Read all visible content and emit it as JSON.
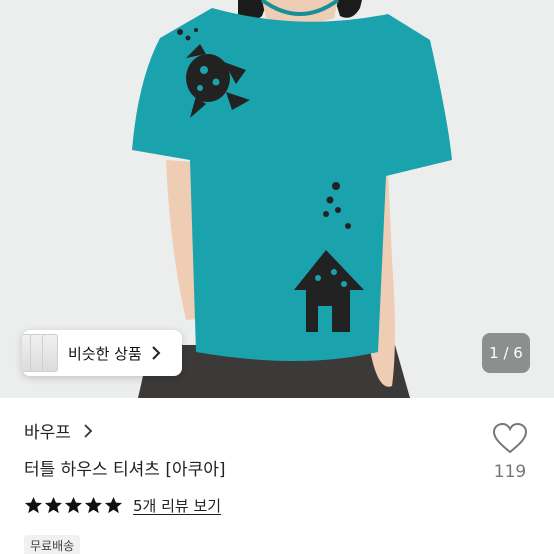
{
  "gallery": {
    "similar_label": "비슷한 상품",
    "counter": "1 / 6",
    "icons": {
      "similar_chevron": "chevron-right-icon"
    }
  },
  "product": {
    "shop_name": "바우프",
    "title": "터틀 하우스 티셔츠 [아쿠아]",
    "rating": 5,
    "rating_max": 5,
    "reviews_link": "5개 리뷰 보기",
    "badge": "무료배송",
    "likes": "119",
    "icons": {
      "shop_chevron": "chevron-right-icon",
      "like": "heart-outline-icon",
      "star": "star-icon"
    }
  },
  "colors": {
    "shirt": "#1aa3ad",
    "print": "#222222",
    "counter_bg": "#6e6e6e"
  }
}
